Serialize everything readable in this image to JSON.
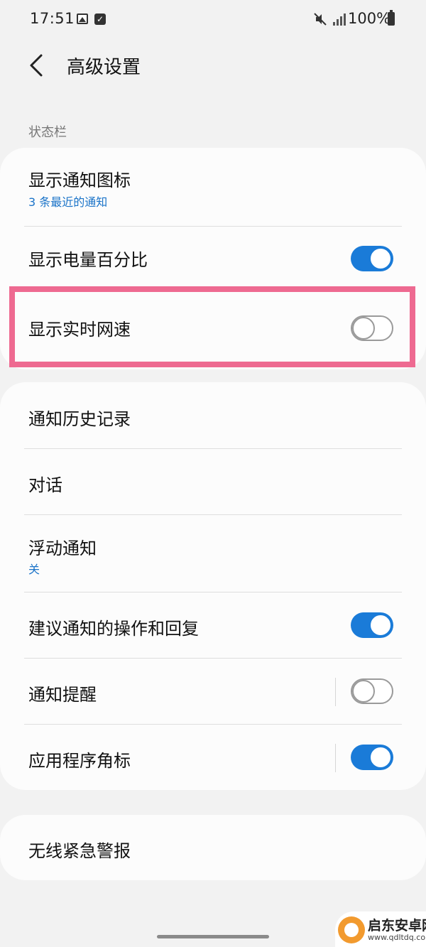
{
  "status_bar": {
    "time": "17:51",
    "battery": "100%"
  },
  "header": {
    "title": "高级设置"
  },
  "status_section": {
    "label": "状态栏",
    "items": [
      {
        "title": "显示通知图标",
        "subtitle": "3 条最近的通知"
      },
      {
        "title": "显示电量百分比",
        "toggle": true
      },
      {
        "title": "显示实时网速",
        "toggle": false
      }
    ]
  },
  "notifications_section": {
    "items": [
      {
        "title": "通知历史记录"
      },
      {
        "title": "对话"
      },
      {
        "title": "浮动通知",
        "subtitle": "关"
      },
      {
        "title": "建议通知的操作和回复",
        "toggle": true
      },
      {
        "title": "通知提醒",
        "toggle": false
      },
      {
        "title": "应用程序角标",
        "toggle": true
      }
    ]
  },
  "emergency_section": {
    "items": [
      {
        "title": "无线紧急警报"
      }
    ]
  },
  "watermark": {
    "title": "启东安卓网",
    "url": "www.qdltdq.com"
  },
  "colors": {
    "accent": "#1a7bd8",
    "highlight": "#ee6a91",
    "background": "#f2f2f2",
    "card": "#fcfcfc"
  },
  "icons": [
    "gallery-icon",
    "check-icon",
    "mute-icon",
    "signal-icon",
    "battery-icon",
    "back-icon"
  ]
}
